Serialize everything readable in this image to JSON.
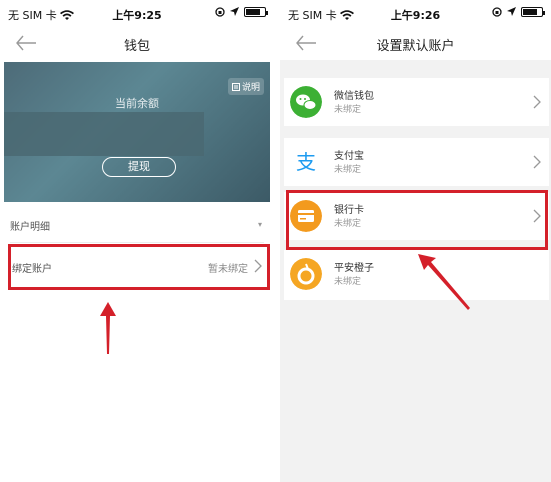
{
  "left": {
    "status": {
      "carrier": "无 SIM 卡",
      "time": "上午9:25"
    },
    "nav_title": "钱包",
    "card": {
      "explain": "说明",
      "balance_label": "当前余额",
      "withdraw": "提现"
    },
    "detail_label": "账户明细",
    "bind_label": "绑定账户",
    "bind_status": "暂未绑定"
  },
  "right": {
    "status": {
      "carrier": "无 SIM 卡",
      "time": "上午9:26"
    },
    "nav_title": "设置默认账户",
    "items": [
      {
        "name": "微信钱包",
        "status": "未绑定",
        "color": "#3cb034"
      },
      {
        "name": "支付宝",
        "status": "未绑定",
        "color": "#1d9bf0"
      },
      {
        "name": "银行卡",
        "status": "未绑定",
        "color": "#f39a1e"
      },
      {
        "name": "平安橙子",
        "status": "未绑定",
        "color": "#f5a623"
      }
    ]
  },
  "colors": {
    "highlight": "#d4202a",
    "card": "#4d6b78"
  },
  "icons": [
    "wifi-icon",
    "battery-icon",
    "back-arrow-icon",
    "chevron-right-icon",
    "explain-icon",
    "wechat-icon",
    "alipay-icon",
    "bank-card-icon",
    "pingan-orange-icon"
  ]
}
